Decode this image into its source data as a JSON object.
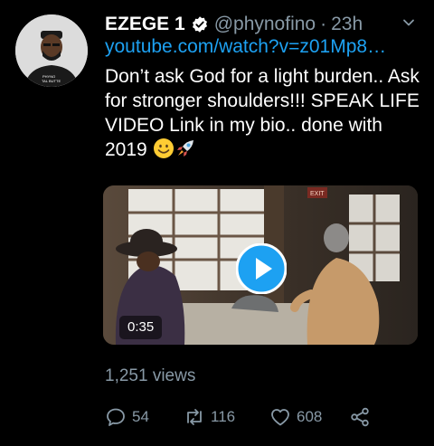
{
  "tweet": {
    "display_name": "EZEGE 1",
    "handle": "@phynofino",
    "separator": "·",
    "time": "23h",
    "link": "youtube.com/watch?v=z01Mp8…",
    "text": "Don’t  ask God for a light burden.. Ask for stronger shoulders!!! SPEAK LIFE VIDEO Link in my bio.. done with 2019",
    "avatar_text": "PHYNO",
    "avatar_subtext": "TAL BUTTE",
    "emojis": [
      "smiling-face-emoji",
      "rocket-emoji"
    ]
  },
  "video": {
    "duration": "0:35",
    "exit_sign": "EXIT"
  },
  "stats": {
    "views": "1,251 views",
    "replies": "54",
    "retweets": "116",
    "likes": "608"
  },
  "icons": [
    "verified-badge-icon",
    "chevron-down-icon",
    "play-icon",
    "reply-icon",
    "retweet-icon",
    "like-icon",
    "share-icon"
  ],
  "colors": {
    "background": "#000000",
    "link": "#1da1f2",
    "muted": "#8899a6",
    "play_button": "#1da1f2"
  }
}
